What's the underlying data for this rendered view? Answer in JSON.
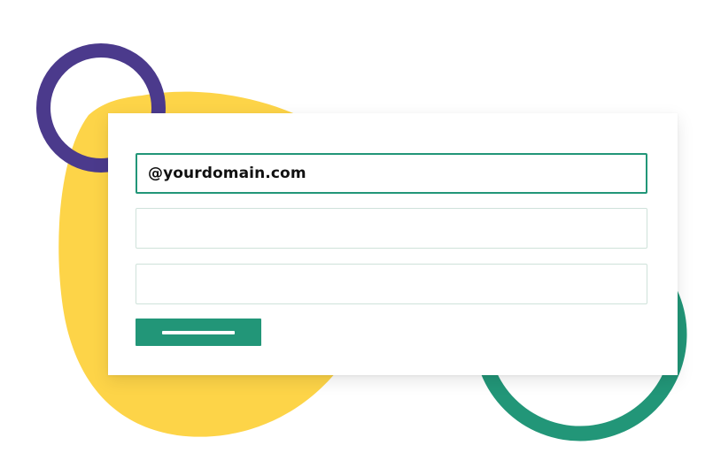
{
  "form": {
    "email_value": "@yourdomain.com",
    "field_2_value": "",
    "field_3_value": ""
  },
  "submit_button": {
    "label": "",
    "icon": "label-placeholder-bar"
  },
  "decorations": {
    "purple_ring": "ring-shape",
    "yellow_blob": "blob-shape",
    "green_ring": "ring-shape"
  },
  "colors": {
    "purple": "#4b3a8c",
    "yellow": "#fdd448",
    "green": "#229678",
    "field_border": "#cfe2da",
    "active_border": "#229678"
  }
}
